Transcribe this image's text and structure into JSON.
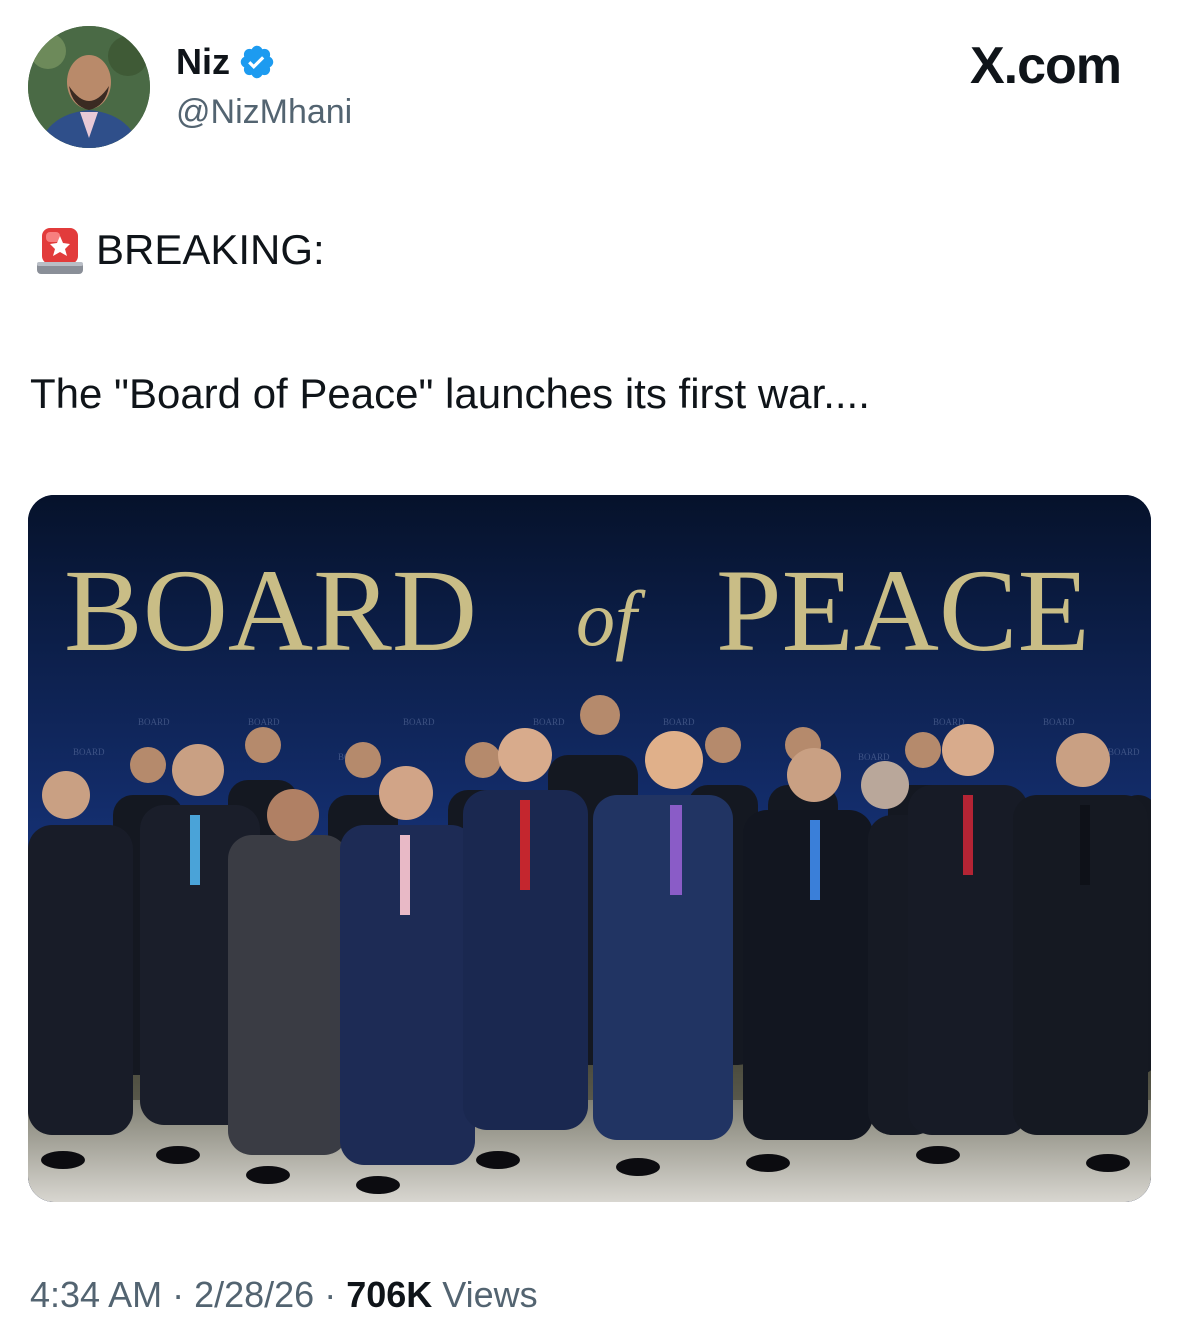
{
  "author": {
    "display_name": "Niz",
    "handle": "@NizMhani",
    "verified": true,
    "avatar_icon": "profile-photo"
  },
  "brand": {
    "label": "X.com"
  },
  "tweet": {
    "emoji_icon": "police-light-icon",
    "breaking_label": "BREAKING:",
    "text": "The \"Board of Peace\" launches its first war...."
  },
  "media": {
    "backdrop_title_part1": "BOARD",
    "backdrop_title_of": "of",
    "backdrop_title_part2": "PEACE",
    "description_icon": "group-photo"
  },
  "meta": {
    "time": "4:34 AM",
    "sep1": " · ",
    "date": "2/28/26",
    "sep2": " · ",
    "views_count": "706K",
    "views_label": " Views"
  },
  "colors": {
    "verified_blue": "#1d9bf0",
    "muted_text": "#536471",
    "primary_text": "#0f1419",
    "backdrop_gold": "#c9bd86"
  }
}
